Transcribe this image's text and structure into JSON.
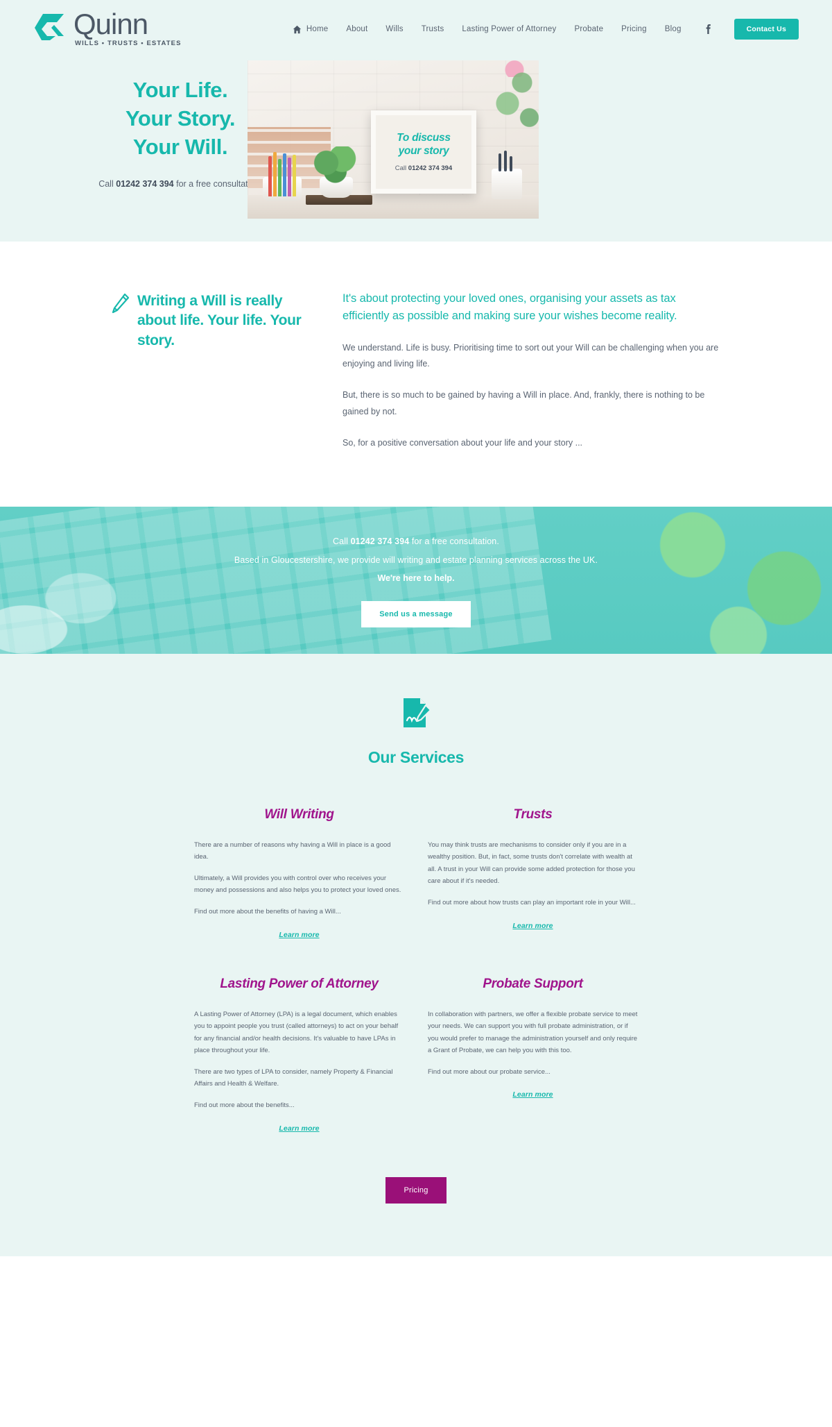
{
  "brand": {
    "name": "Quinn",
    "tagline": "WILLS • TRUSTS • ESTATES",
    "accent": "#17b8ac",
    "purple": "#a0148c",
    "pricing_purple": "#9a1078",
    "page_bg": "#e9f5f3"
  },
  "nav": {
    "items": [
      {
        "label": "Home",
        "icon": "home-icon"
      },
      {
        "label": "About"
      },
      {
        "label": "Wills"
      },
      {
        "label": "Trusts"
      },
      {
        "label": "Lasting Power of Attorney"
      },
      {
        "label": "Probate"
      },
      {
        "label": "Pricing"
      },
      {
        "label": "Blog"
      }
    ],
    "social": "facebook-icon",
    "contact_label": "Contact Us"
  },
  "hero": {
    "title_line1": "Your Life.",
    "title_line2": "Your Story.",
    "title_line3": "Your Will.",
    "call_prefix": "Call ",
    "phone": "01242 374 394",
    "call_suffix": " for a free consultation.",
    "frame_line1": "To discuss",
    "frame_line2": "your story",
    "frame_call_prefix": "Call ",
    "frame_phone": "01242 374 394"
  },
  "writing": {
    "icon": "pencil-icon",
    "title": "Writing a Will is really about life. Your life. Your story.",
    "lead": "It's about protecting your loved ones, organising your assets as tax efficiently as possible and making sure your wishes become reality.",
    "p1": "We understand. Life is busy. Prioritising time to sort out your Will can be challenging when you are enjoying and living life.",
    "p2": "But, there is so much to be gained by having a Will in place. And, frankly, there is nothing to be gained by not.",
    "p3": "So, for a positive conversation about your life and your story ..."
  },
  "cta": {
    "call_prefix": "Call ",
    "phone": "01242 374 394",
    "call_suffix": " for a free consultation.",
    "line2": "Based in Gloucestershire, we provide will writing and estate planning services across the UK.",
    "line3": "We're here to help.",
    "button_label": "Send us a message"
  },
  "services": {
    "icon": "document-sign-icon",
    "title": "Our Services",
    "cards": [
      {
        "title": "Will Writing",
        "paragraphs": [
          "There are a number of reasons why having a Will in place is a good idea.",
          "Ultimately, a Will provides you with control over who receives your money and possessions and also helps you to protect your loved ones.",
          "Find out more about the benefits of having a Will..."
        ],
        "link": "Learn more"
      },
      {
        "title": "Trusts",
        "paragraphs": [
          "You may think trusts are mechanisms to consider only if you are in a wealthy position. But, in fact, some trusts don't correlate with wealth at all. A trust in your Will can provide some added protection for those you care about if it's needed.",
          "Find out more about how trusts can play an important role in your Will..."
        ],
        "link": "Learn more"
      },
      {
        "title": "Lasting Power of Attorney",
        "paragraphs": [
          "A Lasting Power of Attorney (LPA) is a legal document, which enables you to appoint people you trust (called attorneys) to act on your behalf for any financial and/or health decisions.  It's valuable to have LPAs in place throughout your life.",
          "There are two types of LPA to consider, namely Property & Financial Affairs and Health & Welfare.",
          "Find out more about the benefits..."
        ],
        "link": "Learn more"
      },
      {
        "title": "Probate Support",
        "paragraphs": [
          "In collaboration with partners, we offer a flexible probate service to meet your needs. We can support you with full probate administration, or if you would prefer to manage the administration yourself and only require a Grant of Probate, we can help you with this too.",
          "Find out more about our probate service..."
        ],
        "link": "Learn more"
      }
    ],
    "pricing_label": "Pricing"
  }
}
